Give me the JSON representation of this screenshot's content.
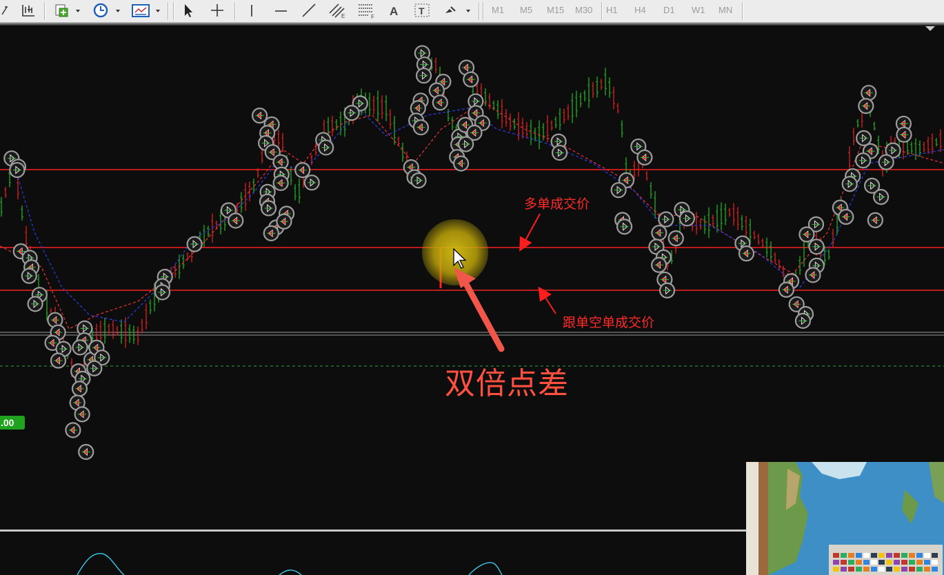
{
  "toolbar": {
    "timeframes": [
      "M1",
      "M5",
      "M15",
      "M30",
      "H1",
      "H4",
      "D1",
      "W1",
      "MN"
    ]
  },
  "annotations": {
    "buy_fill": "多单成交价",
    "sell_fill": "跟单空单成交价",
    "spread": "双倍点差"
  },
  "price_tag": ".00",
  "colors": {
    "chart_bg": "#0d0d0d",
    "level_line": "#e02020",
    "annotation": "#ff2a2a",
    "highlight": "#d2b414"
  }
}
